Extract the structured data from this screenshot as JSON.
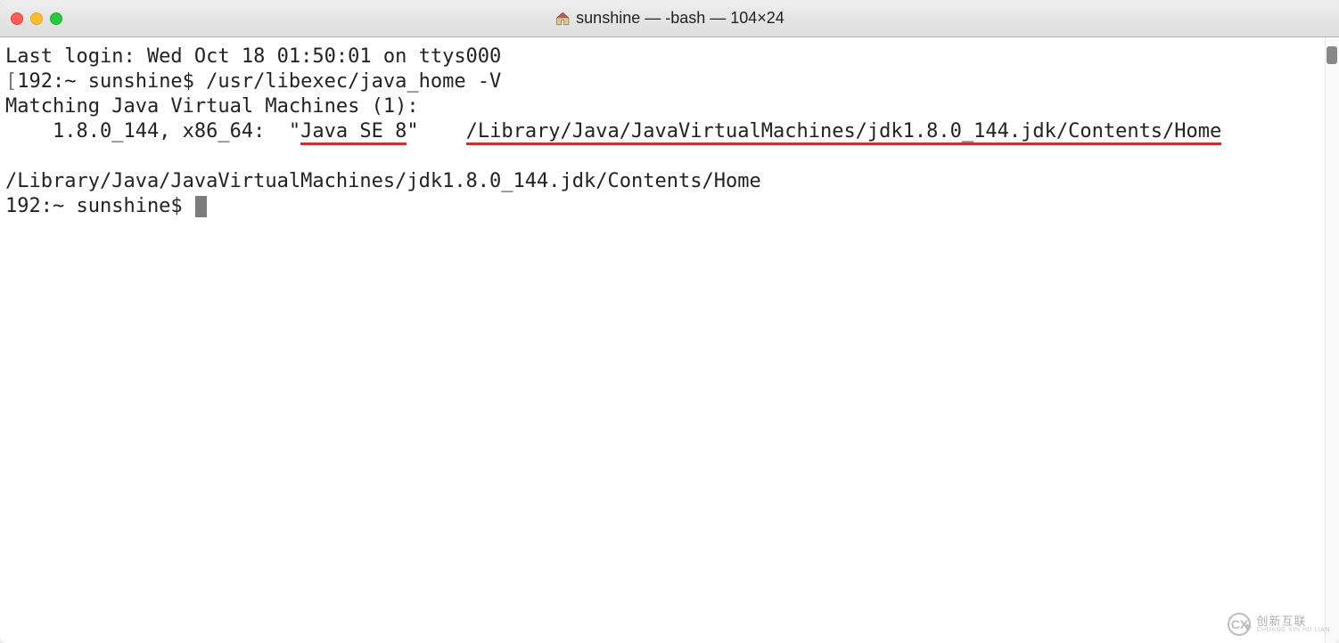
{
  "window": {
    "title": "sunshine — -bash — 104×24"
  },
  "terminal": {
    "line1": "Last login: Wed Oct 18 01:50:01 on ttys000",
    "line2_prefix_bracket": "[",
    "line2_prompt": "192:~ sunshine$ ",
    "line2_cmd": "/usr/libexec/java_home -V",
    "line3": "Matching Java Virtual Machines (1):",
    "line4_prefix": "    1.8.0_144, x86_64:  \"",
    "line4_javase": "Java SE 8",
    "line4_quote_gap": "\"    ",
    "line4_path": "/Library/Java/JavaVirtualMachines/jdk1.8.0_144.jdk/Contents/Home",
    "line5_blank": "",
    "line6": "/Library/Java/JavaVirtualMachines/jdk1.8.0_144.jdk/Contents/Home",
    "line7_prompt": "192:~ sunshine$ "
  },
  "watermark": {
    "main": "创新互联",
    "sub": "CHUANG XIN HU LIAN"
  }
}
